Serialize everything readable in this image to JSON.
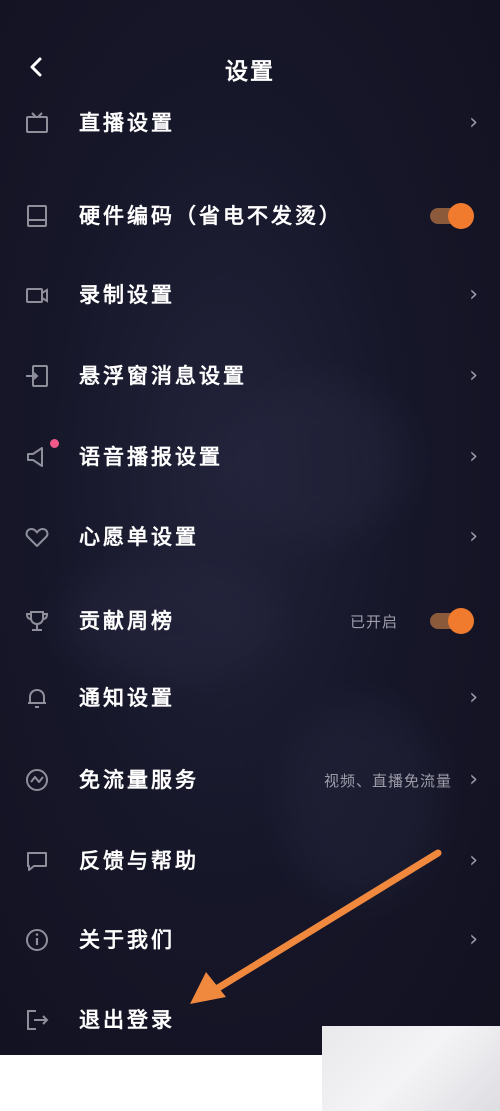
{
  "header": {
    "title": "设置",
    "back_icon": "chevron-left-icon"
  },
  "rows": [
    {
      "label": "直播设置",
      "icon": "tv-icon",
      "control": "chevron"
    },
    {
      "label": "硬件编码（省电不发烫）",
      "icon": "device-icon",
      "control": "toggle",
      "toggle_on": true
    },
    {
      "label": "录制设置",
      "icon": "video-camera-icon",
      "control": "chevron"
    },
    {
      "label": "悬浮窗消息设置",
      "icon": "floating-window-icon",
      "control": "chevron"
    },
    {
      "label": "语音播报设置",
      "icon": "speaker-icon",
      "control": "chevron",
      "badge_dot": true
    },
    {
      "label": "心愿单设置",
      "icon": "heart-icon",
      "control": "chevron"
    },
    {
      "label": "贡献周榜",
      "icon": "trophy-icon",
      "control": "toggle",
      "toggle_on": true,
      "value": "已开启"
    },
    {
      "label": "通知设置",
      "icon": "bell-icon",
      "control": "chevron"
    },
    {
      "label": "免流量服务",
      "icon": "data-free-icon",
      "control": "chevron",
      "value": "视频、直播免流量"
    },
    {
      "label": "反馈与帮助",
      "icon": "message-icon",
      "control": "chevron"
    },
    {
      "label": "关于我们",
      "icon": "info-icon",
      "control": "chevron"
    },
    {
      "label": "退出登录",
      "icon": "logout-icon",
      "control": "none"
    }
  ],
  "colors": {
    "background": "#17172a",
    "text": "#ffffff",
    "accent_orange": "#f07b2e",
    "badge_pink": "#ef5a8a",
    "annotation_arrow": "#f0883e"
  }
}
